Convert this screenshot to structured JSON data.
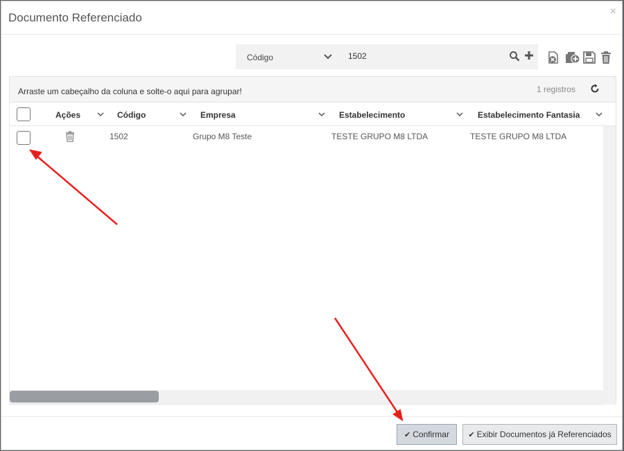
{
  "dialog": {
    "title": "Documento Referenciado",
    "close_glyph": "×"
  },
  "search": {
    "field_label": "Código",
    "value": "1502"
  },
  "toolbar": {
    "icons": [
      "clear-filter-icon",
      "add-to-list-icon",
      "save-icon",
      "trash-icon"
    ]
  },
  "grid": {
    "group_hint": "Arraste um cabeçalho da coluna e solte-o aqui para agrupar!",
    "record_count": "1 registros",
    "columns": [
      "Ações",
      "Código",
      "Empresa",
      "Estabelecimento",
      "Estabelecimento Fantasia"
    ],
    "rows": [
      {
        "codigo": "1502",
        "empresa": "Grupo M8 Teste",
        "estabelecimento": "TESTE GRUPO M8 LTDA",
        "fantasia": "TESTE GRUPO M8 LTDA"
      }
    ],
    "horizontal_scroll_fraction": 0.25
  },
  "footer": {
    "confirm_label": "Confirmar",
    "show_referenced_label": "Exibir Documentos já Referenciados",
    "check_glyph": "✔"
  },
  "colors": {
    "annotation_arrow": "#e8201d",
    "scroll_thumb": "#9a9ea3",
    "confirm_bg": "#d3d9df"
  }
}
